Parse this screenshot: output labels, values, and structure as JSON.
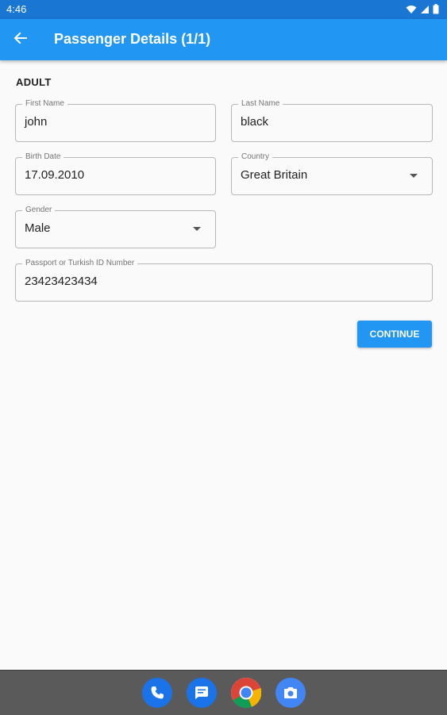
{
  "status_bar": {
    "time": "4:46",
    "icons": [
      "wifi-icon",
      "signal-icon",
      "battery-icon"
    ]
  },
  "app_bar": {
    "back_icon": "arrow-back-icon",
    "title": "Passenger Details (1/1)"
  },
  "form": {
    "section_label": "ADULT",
    "first_name": {
      "label": "First Name",
      "value": "john"
    },
    "last_name": {
      "label": "Last Name",
      "value": "black"
    },
    "birth_date": {
      "label": "Birth Date",
      "value": "17.09.2010"
    },
    "country": {
      "label": "Country",
      "value": "Great Britain"
    },
    "gender": {
      "label": "Gender",
      "value": "Male"
    },
    "passport": {
      "label": "Passport or Turkish ID Number",
      "value": "23423423434"
    },
    "continue_label": "CONTINUE"
  },
  "dock": {
    "apps": [
      "phone-icon",
      "messages-icon",
      "chrome-icon",
      "camera-icon"
    ]
  },
  "colors": {
    "status_bar": "#1976d2",
    "app_bar": "#2196f3",
    "button": "#2196f3",
    "nav_bar": "#5a5a5a"
  }
}
